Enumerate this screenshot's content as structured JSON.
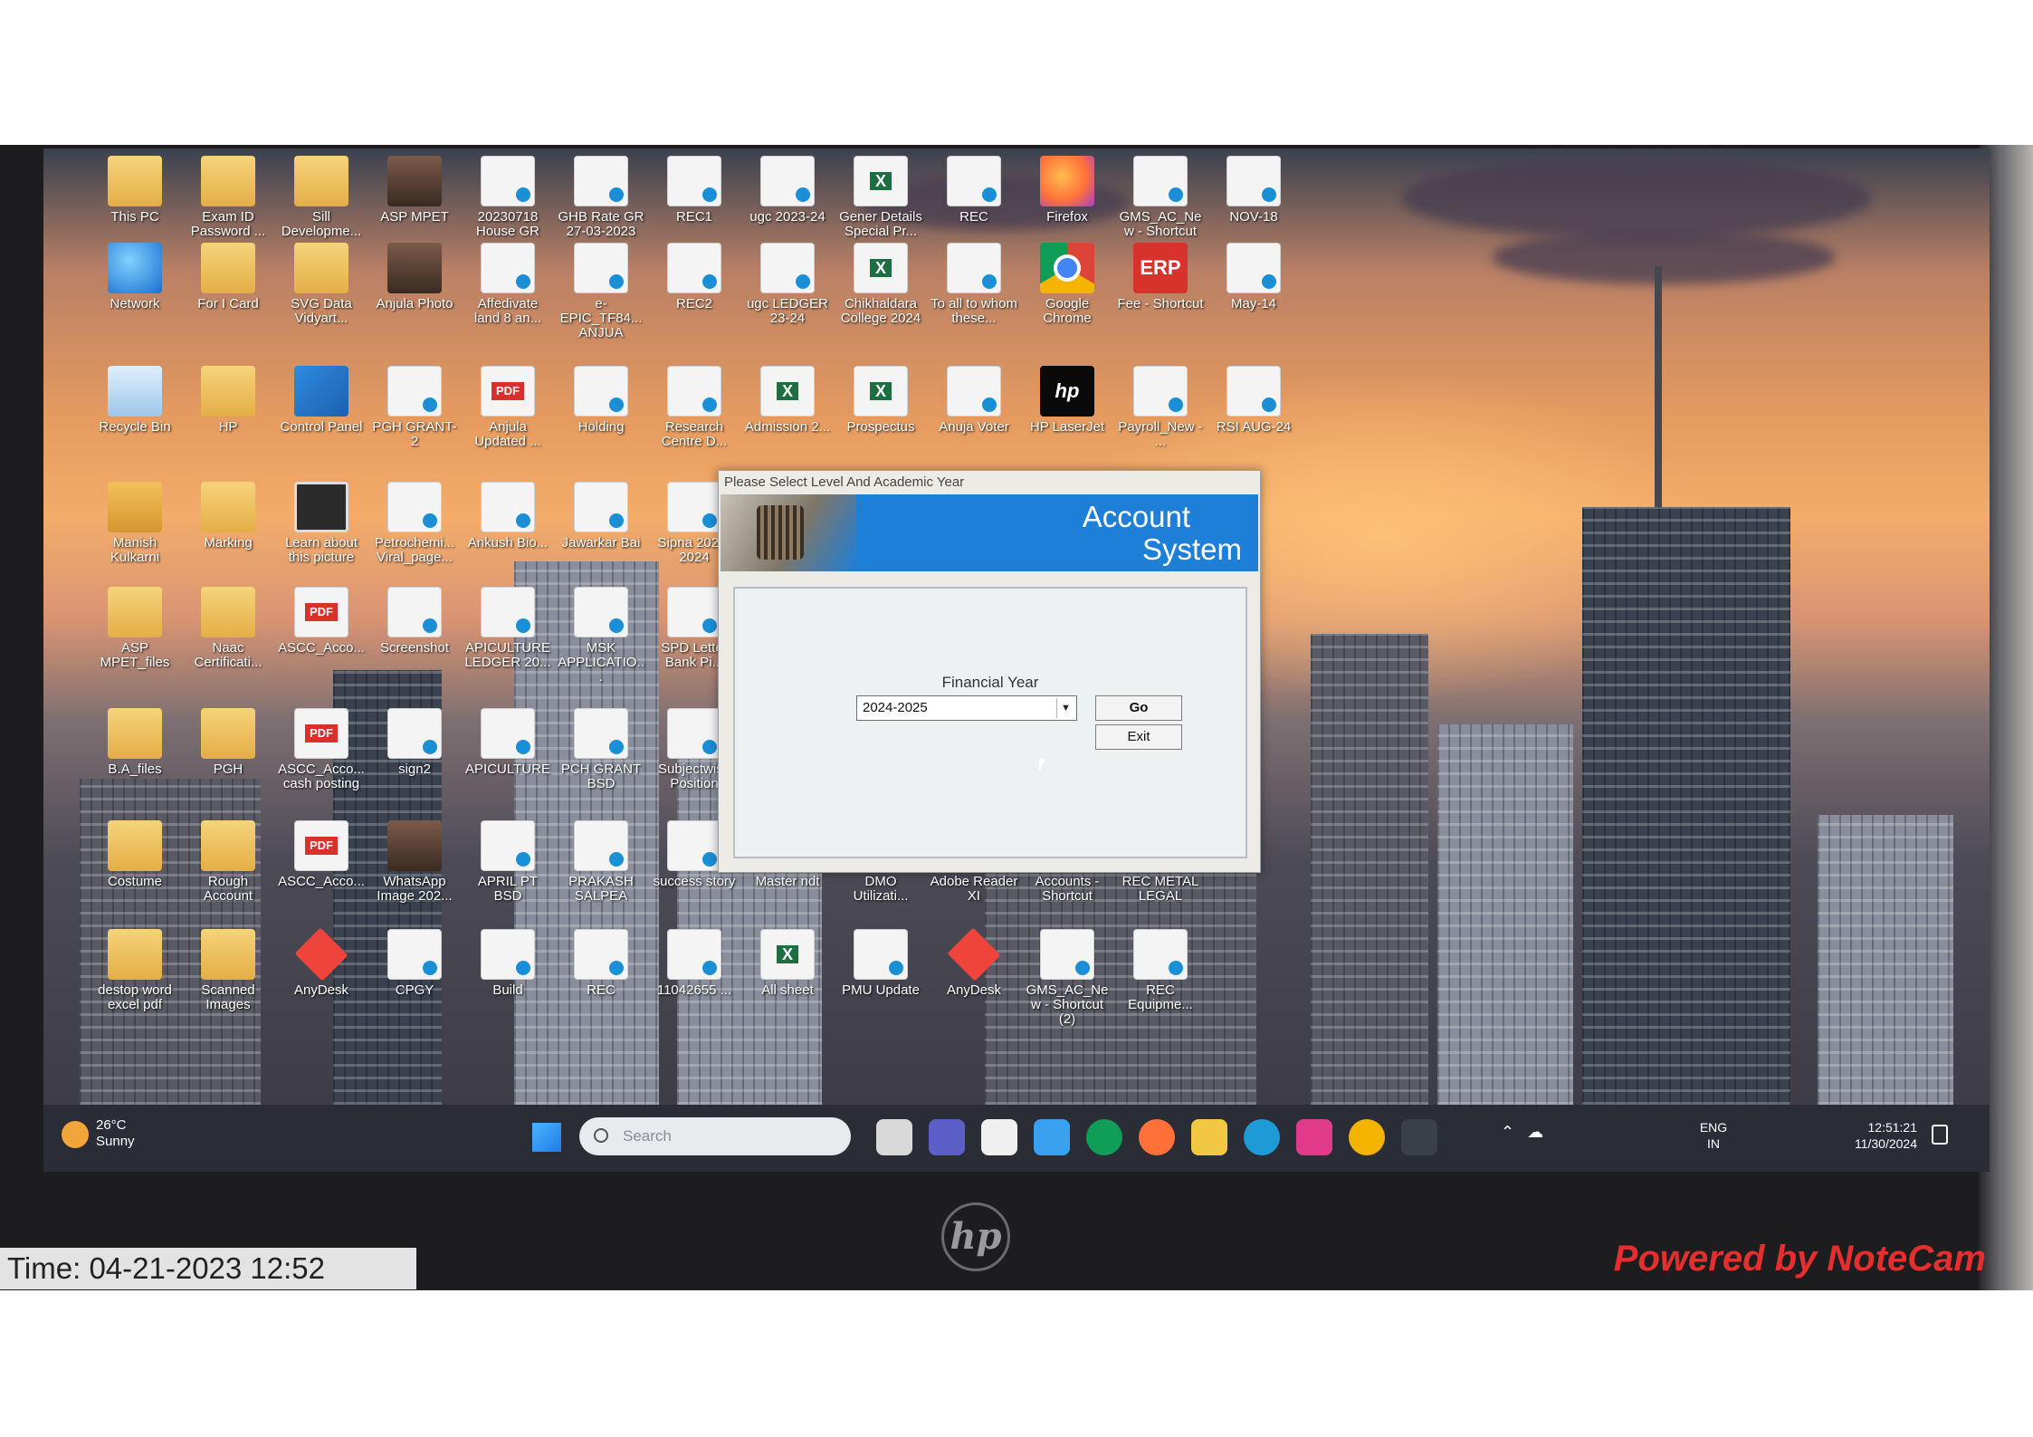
{
  "desktop": {
    "icons": [
      {
        "label": "This PC",
        "glyph": "folder",
        "icon": "computer-icon"
      },
      {
        "label": "Exam ID Password ...",
        "glyph": "folder",
        "icon": "folder-icon"
      },
      {
        "label": "Sill Developme...",
        "glyph": "folder",
        "icon": "folder-icon"
      },
      {
        "label": "ASP MPET",
        "glyph": "photo",
        "icon": "image-icon"
      },
      {
        "label": "20230718 House GR",
        "glyph": "doc",
        "icon": "document-icon"
      },
      {
        "label": "GHB Rate GR 27-03-2023",
        "glyph": "doc",
        "icon": "document-icon"
      },
      {
        "label": "REC1",
        "glyph": "doc",
        "icon": "document-icon"
      },
      {
        "label": "ugc 2023-24",
        "glyph": "doc",
        "icon": "document-icon"
      },
      {
        "label": "Gener Details Special Pr...",
        "glyph": "excel",
        "icon": "excel-icon"
      },
      {
        "label": "REC",
        "glyph": "doc",
        "icon": "document-icon"
      },
      {
        "label": "Firefox",
        "glyph": "firefox",
        "icon": "firefox-icon"
      },
      {
        "label": "GMS_AC_New - Shortcut",
        "glyph": "doc",
        "icon": "shortcut-icon"
      },
      {
        "label": "NOV-18",
        "glyph": "doc",
        "icon": "document-icon"
      },
      {
        "label": "Network",
        "glyph": "net",
        "icon": "network-icon"
      },
      {
        "label": "For I Card",
        "glyph": "folder",
        "icon": "folder-icon"
      },
      {
        "label": "SVG Data Vidyart...",
        "glyph": "folder",
        "icon": "folder-icon"
      },
      {
        "label": "Anjula Photo",
        "glyph": "photo",
        "icon": "image-icon"
      },
      {
        "label": "Affedivate land 8 an...",
        "glyph": "doc",
        "icon": "document-icon"
      },
      {
        "label": "e-EPIC_TF84... ANJUA",
        "glyph": "doc",
        "icon": "document-icon"
      },
      {
        "label": "REC2",
        "glyph": "doc",
        "icon": "document-icon"
      },
      {
        "label": "ugc LEDGER 23-24",
        "glyph": "doc",
        "icon": "document-icon"
      },
      {
        "label": "Chikhaldara College 2024",
        "glyph": "excel",
        "icon": "excel-icon"
      },
      {
        "label": "To all to whom these...",
        "glyph": "doc",
        "icon": "document-icon"
      },
      {
        "label": "Google Chrome",
        "glyph": "chrome",
        "icon": "chrome-icon"
      },
      {
        "label": "Fee - Shortcut",
        "glyph": "erp",
        "icon": "erp-icon"
      },
      {
        "label": "May-14",
        "glyph": "doc",
        "icon": "document-icon"
      },
      {
        "label": "Recycle Bin",
        "glyph": "recycle",
        "icon": "recycle-bin-icon"
      },
      {
        "label": "HP",
        "glyph": "folder",
        "icon": "folder-icon"
      },
      {
        "label": "Control Panel",
        "glyph": "control",
        "icon": "control-panel-icon"
      },
      {
        "label": "PGH GRANT-2",
        "glyph": "doc",
        "icon": "document-icon"
      },
      {
        "label": "Anjula Updated ...",
        "glyph": "pdf",
        "icon": "pdf-icon"
      },
      {
        "label": "Holding",
        "glyph": "doc",
        "icon": "document-icon"
      },
      {
        "label": "Research Centre D...",
        "glyph": "doc",
        "icon": "document-icon"
      },
      {
        "label": "Admission 2...",
        "glyph": "excel",
        "icon": "excel-icon"
      },
      {
        "label": "Prospectus",
        "glyph": "excel",
        "icon": "excel-icon"
      },
      {
        "label": "Anuja Voter",
        "glyph": "doc",
        "icon": "document-icon"
      },
      {
        "label": "HP LaserJet",
        "glyph": "hp",
        "icon": "hp-icon"
      },
      {
        "label": "Payroll_New - ...",
        "glyph": "doc",
        "icon": "shortcut-icon"
      },
      {
        "label": "RSI AUG-24",
        "glyph": "doc",
        "icon": "document-icon"
      },
      {
        "label": "Manish Kulkarni",
        "glyph": "user",
        "icon": "user-folder-icon"
      },
      {
        "label": "Marking",
        "glyph": "folder",
        "icon": "folder-icon"
      },
      {
        "label": "Learn about this picture",
        "glyph": "learn",
        "icon": "camera-icon"
      },
      {
        "label": "Petrochemi... Viral_page...",
        "glyph": "doc",
        "icon": "document-icon"
      },
      {
        "label": "Ankush Bio...",
        "glyph": "doc",
        "icon": "document-icon"
      },
      {
        "label": "Jawarkar Bai",
        "glyph": "doc",
        "icon": "document-icon"
      },
      {
        "label": "Sipna 2023-2024",
        "glyph": "doc",
        "icon": "document-icon"
      },
      {
        "label": "ASP MPET_files",
        "glyph": "folder",
        "icon": "folder-icon"
      },
      {
        "label": "Naac Certificati...",
        "glyph": "folder",
        "icon": "folder-icon"
      },
      {
        "label": "ASCC_Acco...",
        "glyph": "pdf",
        "icon": "pdf-icon"
      },
      {
        "label": "Screenshot",
        "glyph": "doc",
        "icon": "image-icon"
      },
      {
        "label": "APICULTURE LEDGER 20...",
        "glyph": "doc",
        "icon": "document-icon"
      },
      {
        "label": "MSK APPLICATIO...",
        "glyph": "doc",
        "icon": "document-icon"
      },
      {
        "label": "SPD Letter Bank Pi...",
        "glyph": "doc",
        "icon": "document-icon"
      },
      {
        "label": "B.A_files",
        "glyph": "folder",
        "icon": "folder-icon"
      },
      {
        "label": "PGH",
        "glyph": "folder",
        "icon": "folder-icon"
      },
      {
        "label": "ASCC_Acco... cash posting",
        "glyph": "pdf",
        "icon": "pdf-icon"
      },
      {
        "label": "sign2",
        "glyph": "doc",
        "icon": "image-icon"
      },
      {
        "label": "APICULTURE",
        "glyph": "doc",
        "icon": "document-icon"
      },
      {
        "label": "PCH GRANT BSD",
        "glyph": "doc",
        "icon": "document-icon"
      },
      {
        "label": "Subjectwise Position",
        "glyph": "doc",
        "icon": "document-icon"
      },
      {
        "label": "Costume",
        "glyph": "folder",
        "icon": "folder-icon"
      },
      {
        "label": "Rough Account",
        "glyph": "folder",
        "icon": "folder-icon"
      },
      {
        "label": "ASCC_Acco...",
        "glyph": "pdf",
        "icon": "pdf-icon"
      },
      {
        "label": "WhatsApp Image 202...",
        "glyph": "photo",
        "icon": "image-icon"
      },
      {
        "label": "APRIL PT BSD",
        "glyph": "doc",
        "icon": "document-icon"
      },
      {
        "label": "PRAKASH SALPEA",
        "glyph": "doc",
        "icon": "document-icon"
      },
      {
        "label": "success story",
        "glyph": "doc",
        "icon": "document-icon"
      },
      {
        "label": "Master ndt",
        "glyph": "excel",
        "icon": "excel-icon"
      },
      {
        "label": "DMO Utilizati...",
        "glyph": "doc",
        "icon": "document-icon"
      },
      {
        "label": "Adobe Reader XI",
        "glyph": "pdf",
        "icon": "adobe-reader-icon"
      },
      {
        "label": "Accounts - Shortcut",
        "glyph": "doc",
        "icon": "shortcut-icon"
      },
      {
        "label": "REC METAL LEGAL",
        "glyph": "doc",
        "icon": "document-icon"
      },
      {
        "label": "destop word excel pdf",
        "glyph": "folder",
        "icon": "folder-icon"
      },
      {
        "label": "Scanned Images",
        "glyph": "folder",
        "icon": "folder-icon"
      },
      {
        "label": "AnyDesk",
        "glyph": "anydesk",
        "icon": "anydesk-icon"
      },
      {
        "label": "CPGY",
        "glyph": "doc",
        "icon": "document-icon"
      },
      {
        "label": "Build",
        "glyph": "doc",
        "icon": "document-icon"
      },
      {
        "label": "REC",
        "glyph": "doc",
        "icon": "document-icon"
      },
      {
        "label": "11042655 ...",
        "glyph": "doc",
        "icon": "document-icon"
      },
      {
        "label": "All sheet",
        "glyph": "excel",
        "icon": "excel-icon"
      },
      {
        "label": "PMU Update",
        "glyph": "doc",
        "icon": "document-icon"
      },
      {
        "label": "AnyDesk",
        "glyph": "anydesk",
        "icon": "anydesk-icon"
      },
      {
        "label": "GMS_AC_New - Shortcut (2)",
        "glyph": "doc",
        "icon": "shortcut-icon"
      },
      {
        "label": "REC Equipme...",
        "glyph": "doc",
        "icon": "document-icon"
      }
    ]
  },
  "dialog": {
    "title": "Please Select Level And Academic Year",
    "heading_line1": "Account",
    "heading_line2": "System",
    "financial_year_label": "Financial Year",
    "financial_year_value": "2024-2025",
    "go_label": "Go",
    "exit_label": "Exit"
  },
  "taskbar": {
    "weather_temp": "26°C",
    "weather_desc": "Sunny",
    "search_placeholder": "Search",
    "lang_line1": "ENG",
    "lang_line2": "IN",
    "time": "12:51:21",
    "date": "11/30/2024",
    "apps": [
      "file-explorer-icon",
      "teams-icon",
      "store-icon",
      "photos-icon",
      "chrome-icon",
      "firefox-icon",
      "folder-icon",
      "edge-icon",
      "app-icon",
      "chrome-icon",
      "terminal-icon"
    ]
  },
  "device": {
    "logo": "hp"
  },
  "overlay": {
    "timestamp": "Time: 04-21-2023 12:52",
    "watermark": "Powered by NoteCam"
  },
  "colors": {
    "dialog_banner": "#1d7fd8",
    "watermark": "#e52f2f"
  }
}
